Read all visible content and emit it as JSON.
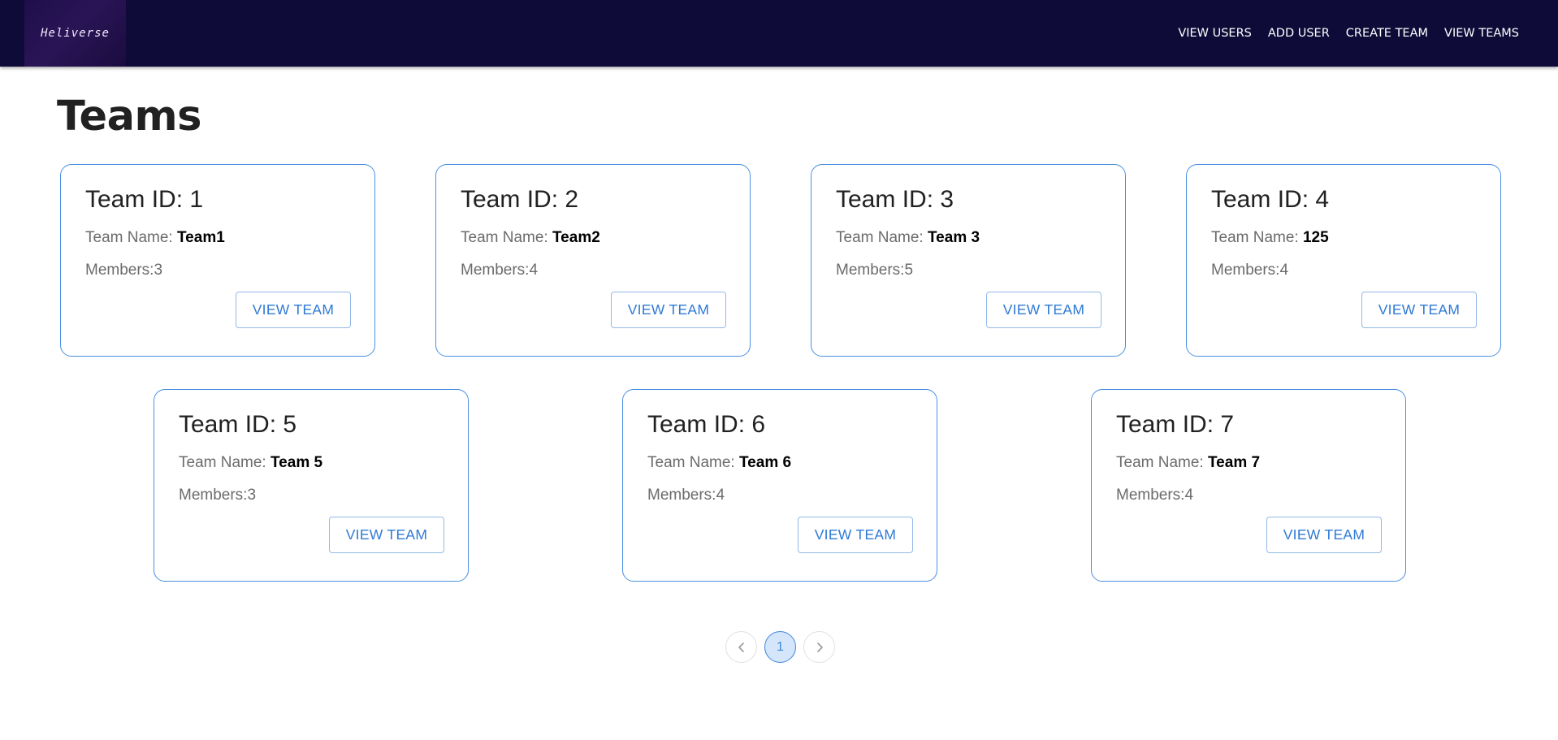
{
  "header": {
    "logo_text": "Heliverse",
    "nav": [
      {
        "label": "VIEW USERS"
      },
      {
        "label": "ADD USER"
      },
      {
        "label": "CREATE TEAM"
      },
      {
        "label": "VIEW TEAMS"
      }
    ]
  },
  "main": {
    "title": "Teams",
    "name_label": "Team Name:",
    "members_label": "Members:",
    "teams": [
      {
        "title": "Team ID: 1",
        "name": "Team1",
        "members": "3",
        "button": "VIEW TEAM"
      },
      {
        "title": "Team ID: 2",
        "name": "Team2",
        "members": "4",
        "button": "VIEW TEAM"
      },
      {
        "title": "Team ID: 3",
        "name": "Team 3",
        "members": "5",
        "button": "VIEW TEAM"
      },
      {
        "title": "Team ID: 4",
        "name": "125",
        "members": "4",
        "button": "VIEW TEAM"
      },
      {
        "title": "Team ID: 5",
        "name": "Team 5",
        "members": "3",
        "button": "VIEW TEAM"
      },
      {
        "title": "Team ID: 6",
        "name": "Team 6",
        "members": "4",
        "button": "VIEW TEAM"
      },
      {
        "title": "Team ID: 7",
        "name": "Team 7",
        "members": "4",
        "button": "VIEW TEAM"
      }
    ]
  },
  "pagination": {
    "current_page": "1",
    "prev_icon": "chevron-left-icon",
    "next_icon": "chevron-right-icon"
  },
  "colors": {
    "navbar": "#0f0b38",
    "card_border": "#4a90e2",
    "button_text": "#2f7ad5",
    "active_page_bg": "#d6e6fa"
  }
}
